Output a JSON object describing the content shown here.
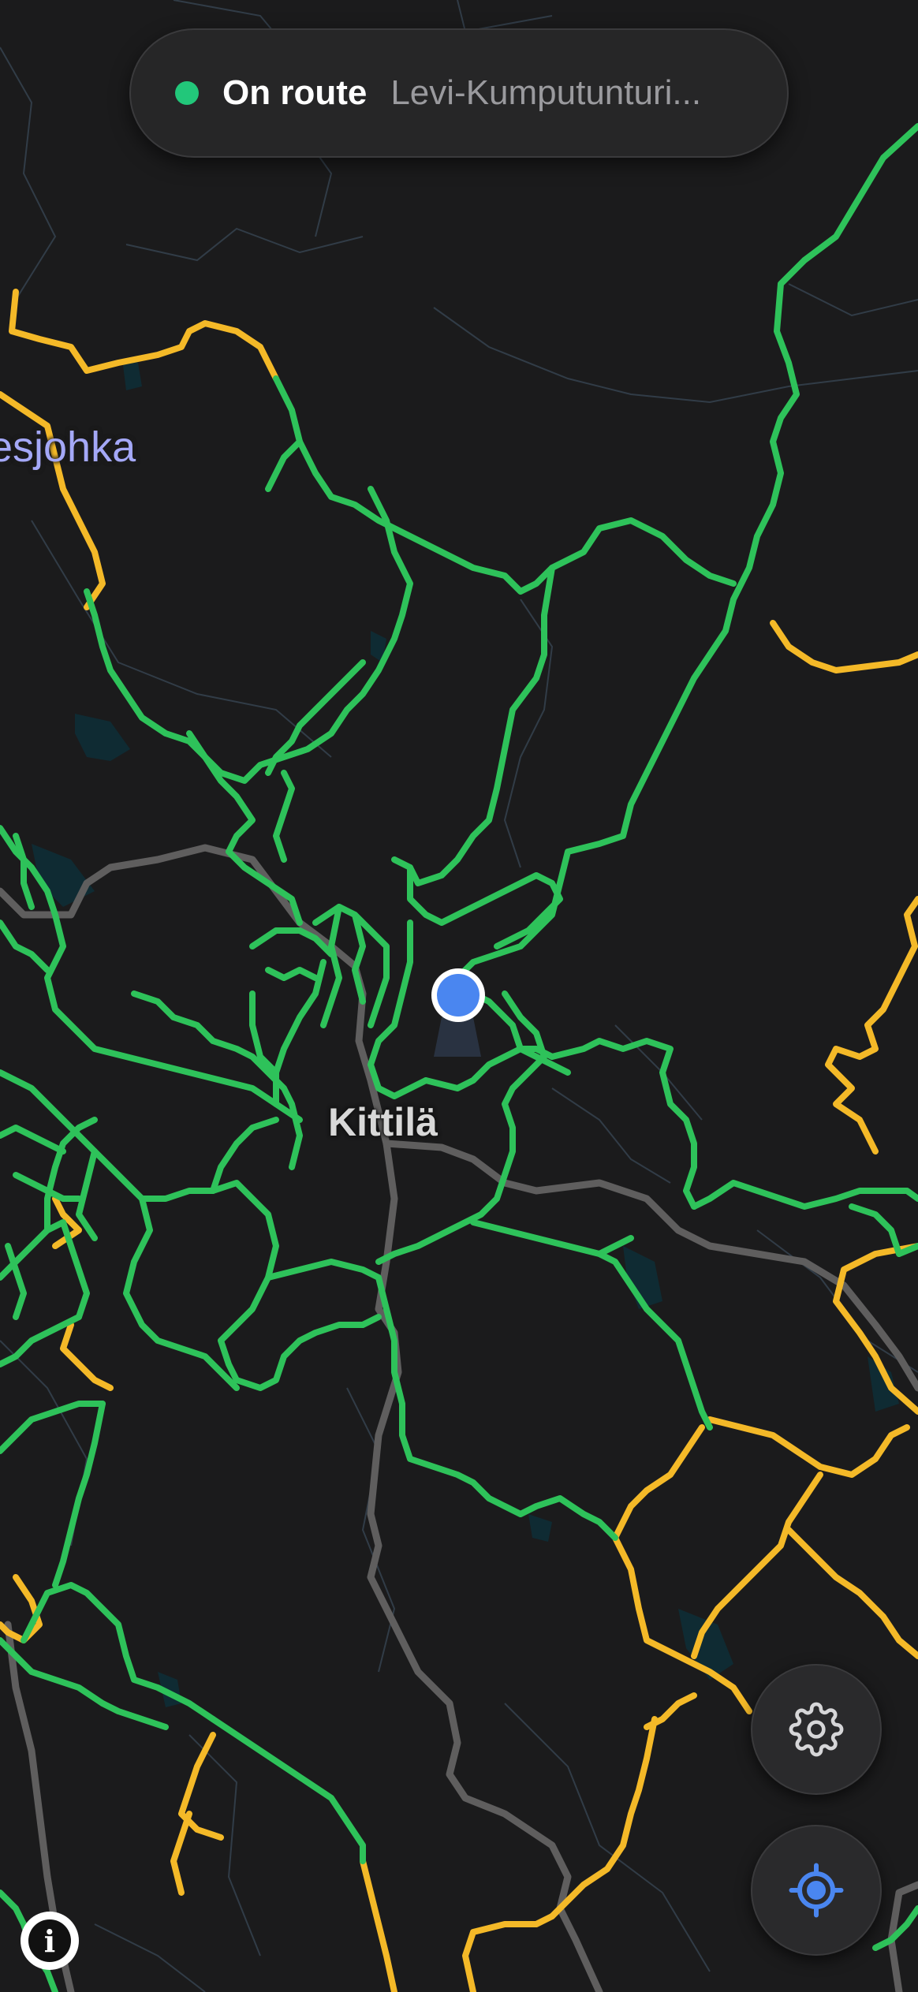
{
  "status": {
    "label": "On route",
    "route_name": "Levi-Kumputunturi...",
    "indicator_color": "#22c77a"
  },
  "map": {
    "place_labels": {
      "water": "esjohka",
      "town": "Kittilä"
    },
    "colors": {
      "background": "#1b1b1c",
      "trail_primary": "#2ec25a",
      "trail_secondary": "#f4b928",
      "road": "#5f5e5e",
      "water": "#0f2b33",
      "terrain_line": "#34404c",
      "user_location": "#4a86f0"
    }
  },
  "controls": {
    "settings_icon": "gear-icon",
    "locate_icon": "crosshair-icon",
    "info_icon": "info-icon"
  }
}
